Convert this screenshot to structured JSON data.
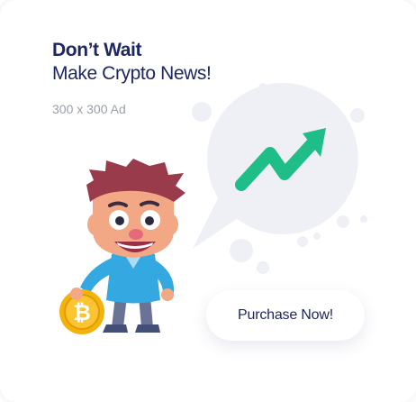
{
  "ad": {
    "headline_line1": "Don’t Wait",
    "headline_line2": "Make Crypto News!",
    "size_label": "300 x 300 Ad",
    "cta_label": "Purchase Now!",
    "coin_symbol": "₿"
  },
  "icons": {
    "speech_bubble": "speech-bubble-icon",
    "trend_arrow": "trend-up-arrow-icon",
    "coin": "bitcoin-coin-icon",
    "character": "cartoon-man-illustration"
  },
  "colors": {
    "headline": "#1e2761",
    "subtle_text": "#9aa0ad",
    "bubble": "#eef0f5",
    "arrow": "#1fbd87",
    "coin": "#f4b30c"
  }
}
